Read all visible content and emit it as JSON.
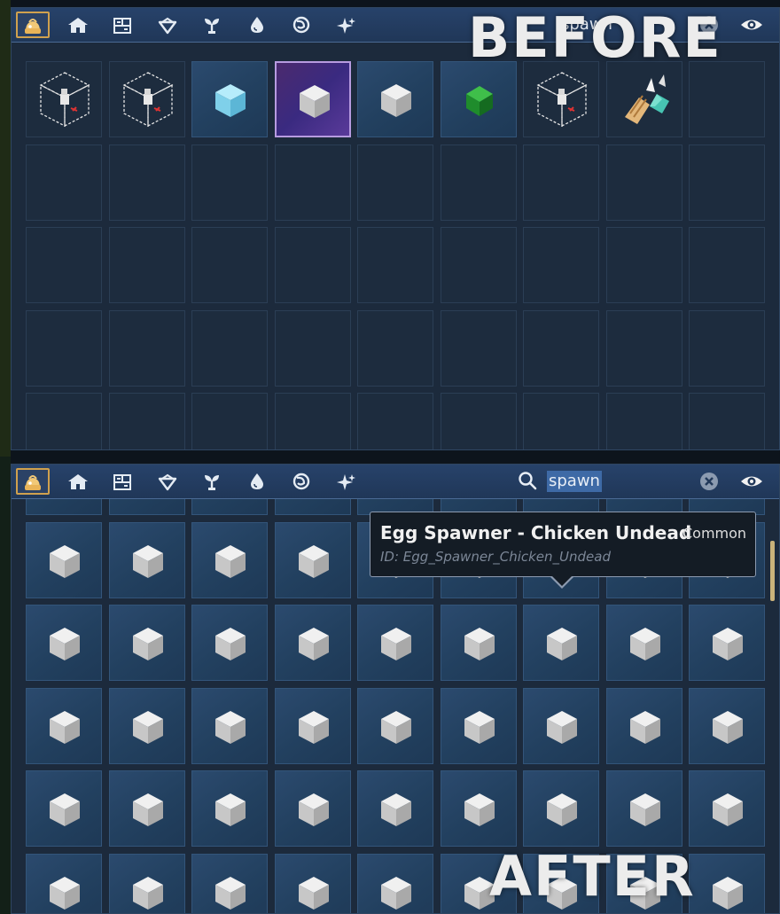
{
  "captions": {
    "before": "BEFORE",
    "after": "AFTER"
  },
  "toolbar": {
    "categories": [
      "backpack-icon",
      "house-icon",
      "furniture-icon",
      "gem-icon",
      "plant-icon",
      "drop-icon",
      "swirl-icon",
      "sparkle-icon"
    ],
    "active_index": 0
  },
  "before": {
    "search": {
      "value": "spawn",
      "selected": false
    },
    "items": [
      "spawner-cage-icon",
      "spawner-cage-icon",
      "ice-cube-icon",
      "egg-cube-icon",
      "egg-cube-icon",
      "green-gem-icon",
      "spawner-cage-icon",
      "hands-gem-icon"
    ],
    "selected_index": 3
  },
  "after": {
    "search": {
      "value": "spawn",
      "selected": true
    },
    "item_icon": "egg-cube-icon",
    "tooltip": {
      "title": "Egg Spawner - Chicken Undead",
      "rarity": "Common",
      "id_line": "ID: Egg_Spawner_Chicken_Undead"
    }
  },
  "colors": {
    "panel": "#1c2a3c",
    "toolbar": "#203758",
    "active_border": "#d0a14e",
    "selected_slot": "#4b2a6e",
    "scrollbar": "#c9b27a"
  }
}
